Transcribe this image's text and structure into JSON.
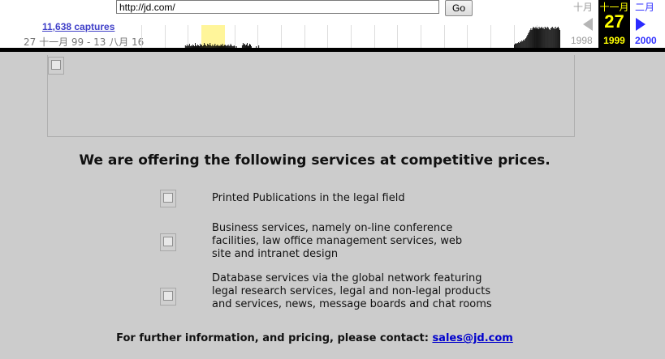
{
  "toolbar": {
    "url": "http://jd.com/",
    "go_label": "Go",
    "captures": "11,638 captures",
    "date_range": "27 十一月 99 - 13 八月 16",
    "sparkline_heights": [
      0,
      0,
      0,
      0,
      0,
      0,
      0,
      0,
      0,
      0,
      0,
      0,
      0,
      0,
      0,
      0,
      0,
      0,
      0,
      0,
      0,
      0,
      0,
      0,
      0,
      0,
      0,
      0,
      0,
      0,
      0,
      0,
      0,
      0,
      0,
      0,
      0,
      0,
      0,
      0,
      0,
      0,
      0,
      0,
      0,
      0,
      0,
      0,
      0,
      0,
      0,
      0,
      0,
      3,
      2,
      4,
      2,
      3,
      5,
      2,
      3,
      2,
      4,
      3,
      2,
      6,
      3,
      2,
      4,
      3,
      2,
      5,
      3,
      4,
      2,
      3,
      6,
      4,
      3,
      2,
      5,
      4,
      3,
      6,
      3,
      2,
      4,
      2,
      3,
      5,
      2,
      3,
      4,
      2,
      3,
      2,
      4,
      3,
      5,
      2,
      3,
      4,
      3,
      2,
      3,
      4,
      2,
      3,
      5,
      3,
      2,
      2,
      3,
      2,
      0,
      2,
      0,
      0,
      0,
      0,
      0,
      0,
      3,
      6,
      4,
      5,
      3,
      4,
      6,
      2,
      3,
      5,
      4,
      2,
      0,
      0,
      0,
      0,
      0,
      2,
      0,
      0,
      3,
      0,
      0,
      0,
      0,
      0,
      0,
      0,
      0,
      0,
      0,
      0,
      0,
      0,
      0,
      0,
      0,
      0,
      0,
      0,
      0,
      0,
      0,
      0,
      0,
      0,
      0,
      0,
      0,
      0,
      0,
      0,
      0,
      0,
      0,
      0,
      0,
      0,
      0,
      0,
      0,
      0,
      0,
      0,
      0,
      0,
      0,
      0,
      0,
      0,
      0,
      0,
      0,
      0,
      0,
      0,
      0,
      0,
      0,
      0,
      0,
      0,
      0,
      0,
      0,
      0,
      0,
      0,
      0,
      0,
      0,
      0,
      0,
      0,
      0,
      0,
      0,
      0,
      0,
      0,
      0,
      0,
      0,
      0,
      0,
      0,
      0,
      0,
      0,
      0,
      0,
      0,
      0,
      0,
      0,
      0,
      0,
      0,
      0,
      0,
      0,
      0,
      0,
      0,
      0,
      0,
      0,
      0,
      0,
      0,
      0,
      0,
      0,
      0,
      0,
      0,
      0,
      0,
      0,
      0,
      0,
      0,
      0,
      0,
      0,
      0,
      0,
      0,
      0,
      0,
      0,
      0,
      0,
      0,
      0,
      0,
      0,
      0,
      0,
      0,
      0,
      0,
      0,
      0,
      0,
      0,
      0,
      0,
      0,
      0,
      0,
      0,
      0,
      0,
      0,
      0,
      0,
      0,
      0,
      0,
      0,
      0,
      0,
      0,
      0,
      0,
      0,
      0,
      0,
      0,
      0,
      0,
      0,
      0,
      0,
      0,
      0,
      0,
      0,
      0,
      0,
      0,
      0,
      0,
      0,
      0,
      0,
      0,
      0,
      0,
      0,
      0,
      0,
      0,
      0,
      0,
      0,
      0,
      0,
      0,
      0,
      0,
      0,
      0,
      0,
      0,
      0,
      0,
      0,
      0,
      0,
      0,
      0,
      0,
      0,
      0,
      0,
      0,
      0,
      0,
      0,
      0,
      0,
      0,
      0,
      0,
      0,
      0,
      0,
      0,
      0,
      0,
      0,
      0,
      0,
      0,
      0,
      0,
      0,
      0,
      0,
      0,
      0,
      0,
      0,
      0,
      0,
      0,
      0,
      0,
      0,
      0,
      0,
      0,
      0,
      0,
      0,
      0,
      0,
      0,
      0,
      0,
      0,
      0,
      0,
      0,
      0,
      0,
      0,
      0,
      0,
      0,
      0,
      0,
      0,
      0,
      0,
      0,
      0,
      0,
      0,
      0,
      0,
      0,
      0,
      0,
      0,
      0,
      0,
      0,
      0,
      0,
      0,
      0,
      0,
      0,
      0,
      0,
      0,
      0,
      0,
      0,
      0,
      0,
      0,
      0,
      0,
      0,
      0,
      0,
      4,
      5,
      6,
      5,
      6,
      7,
      6,
      8,
      7,
      9,
      8,
      10,
      9,
      11,
      12,
      14,
      16,
      18,
      20,
      22,
      24,
      22,
      24,
      26,
      25,
      24,
      26,
      24,
      25,
      23,
      26,
      24,
      25,
      26,
      24,
      25,
      23,
      26,
      25,
      24,
      26,
      25,
      23,
      22,
      24,
      25,
      26,
      24,
      25,
      23,
      26,
      24,
      25,
      26,
      24,
      22
    ],
    "sparkline_highlight_index": 73,
    "calendar": {
      "prev_month": "十月",
      "curr_month": "十一月",
      "next_month": "二月",
      "day": "27",
      "prev_year": "1998",
      "curr_year": "1999",
      "next_year": "2000"
    }
  },
  "page": {
    "headline": "We are offering the following services at competitive prices.",
    "services": [
      "Printed Publications in the legal field",
      "Business services, namely on-line conference facilities, law office management services, web site and intranet design",
      "Database services via the global network featuring legal research services, legal and non-legal products and services, news, message boards and chat rooms"
    ],
    "contact_prefix": "For further information, and pricing, please contact: ",
    "contact_email": "sales@jd.com"
  }
}
